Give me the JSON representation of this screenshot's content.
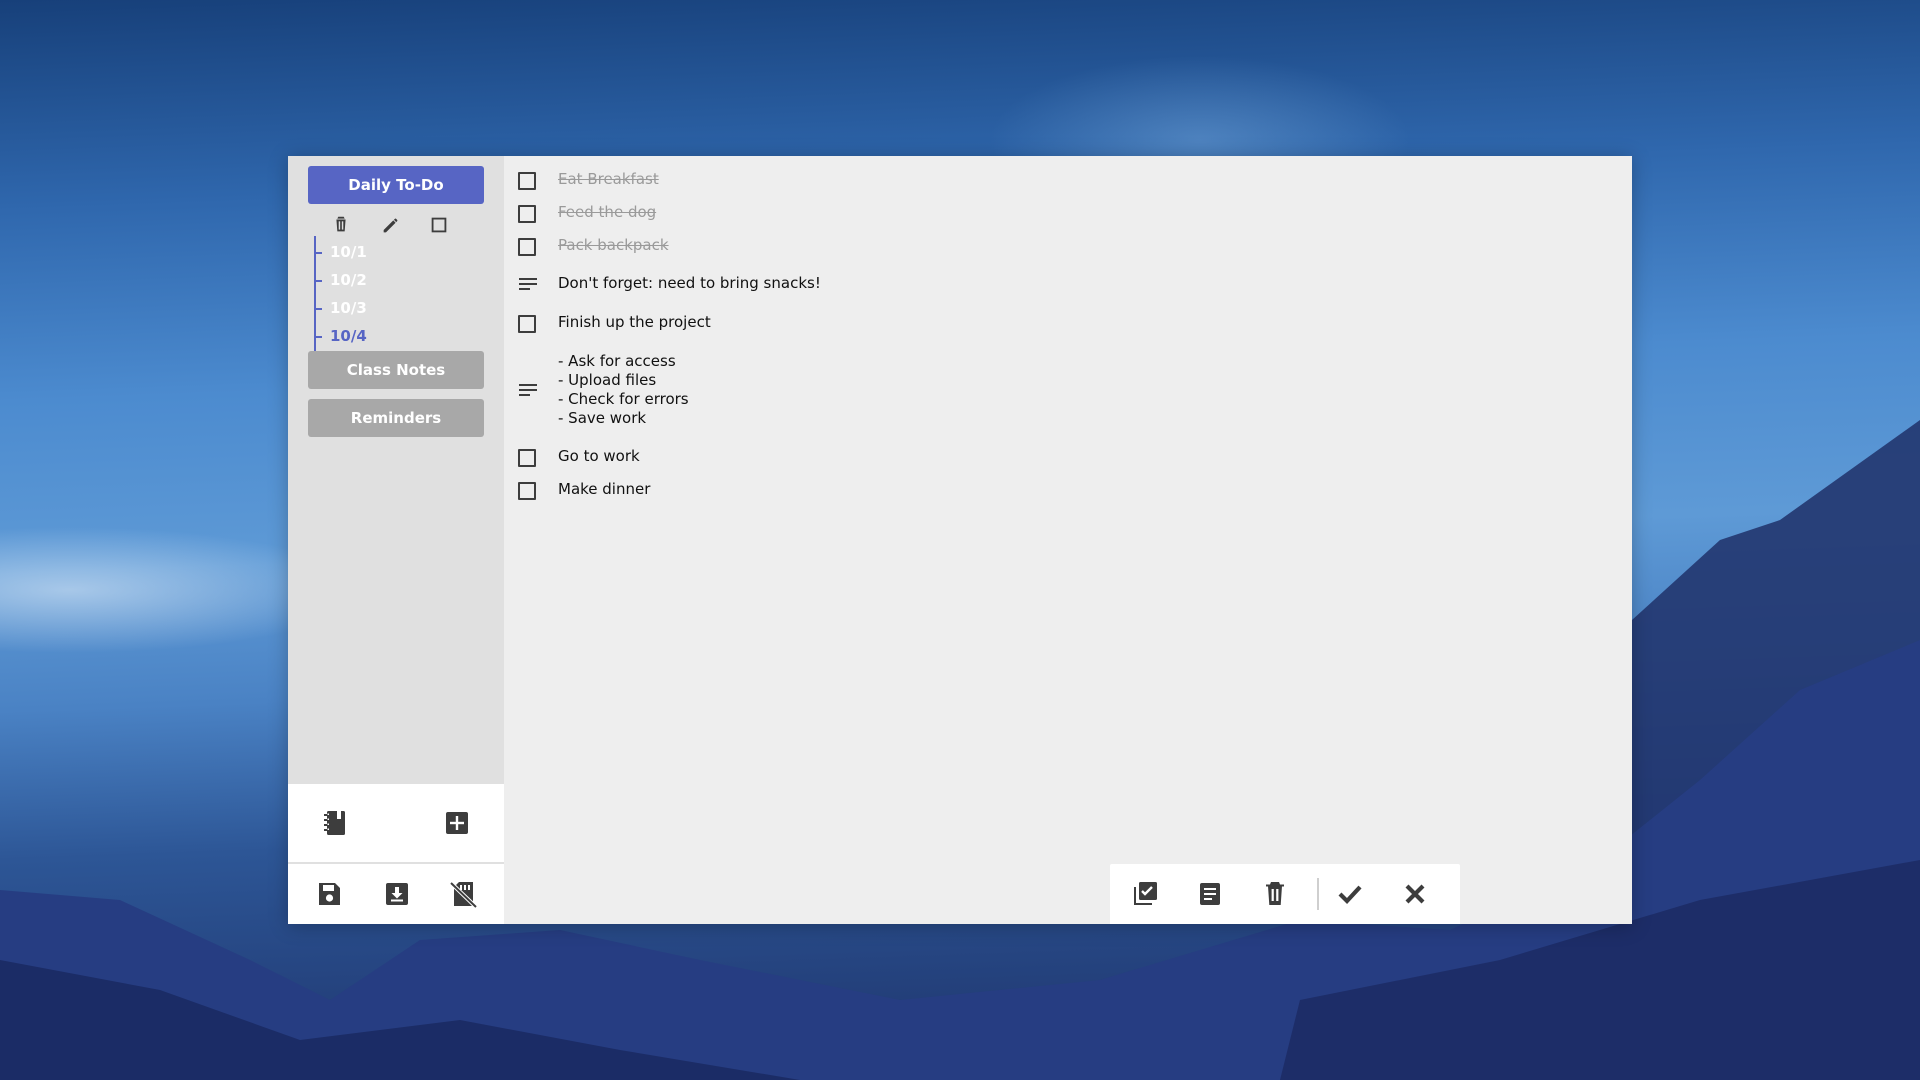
{
  "sidebar": {
    "notebooks": [
      {
        "label": "Daily To-Do",
        "state": "active"
      },
      {
        "label": "Class Notes",
        "state": "inactive"
      },
      {
        "label": "Reminders",
        "state": "inactive"
      }
    ],
    "pages": [
      {
        "label": "10/1",
        "active": false
      },
      {
        "label": "10/2",
        "active": false
      },
      {
        "label": "10/3",
        "active": false
      },
      {
        "label": "10/4",
        "active": true
      }
    ],
    "notebook_action_icons": [
      "delete-icon",
      "edit-icon",
      "checkbox-icon"
    ],
    "bottom_icons": [
      "notebook-icon",
      "add-box-icon",
      "save-icon",
      "download-icon",
      "sd-card-off-icon"
    ]
  },
  "entries": [
    {
      "type": "check",
      "text": "Eat Breakfast",
      "done": true
    },
    {
      "type": "check",
      "text": "Feed the dog",
      "done": true
    },
    {
      "type": "check",
      "text": "Pack backpack",
      "done": true
    },
    {
      "type": "note",
      "text": "Don't forget: need to bring snacks!"
    },
    {
      "type": "check",
      "text": "Finish up the project",
      "done": false
    },
    {
      "type": "note",
      "text": "- Ask for access\n- Upload files\n- Check for errors\n- Save work"
    },
    {
      "type": "check",
      "text": "Go to work",
      "done": false
    },
    {
      "type": "check",
      "text": "Make dinner",
      "done": false
    }
  ],
  "toolbar_icons": [
    "checklist-icon",
    "note-icon",
    "delete-icon",
    "check-icon",
    "close-icon"
  ],
  "colors": {
    "accent": "#5765c4",
    "inactive_button": "#a8a8a8",
    "panel": "#eeeeee",
    "sidebar": "#e0e0e0"
  }
}
